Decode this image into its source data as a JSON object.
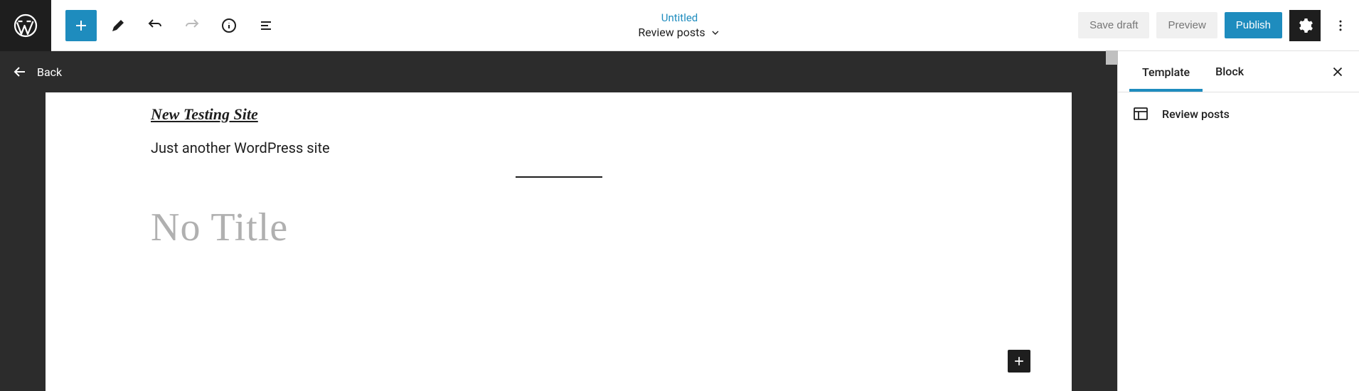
{
  "header": {
    "doc_title": "Untitled",
    "doc_subtitle": "Review posts",
    "save_draft_label": "Save draft",
    "preview_label": "Preview",
    "publish_label": "Publish"
  },
  "editor": {
    "back_label": "Back",
    "site_title": "New Testing Site",
    "site_tagline": "Just another WordPress site",
    "post_title_placeholder": "No Title"
  },
  "sidebar": {
    "tab_template": "Template",
    "tab_block": "Block",
    "template_name": "Review posts"
  }
}
